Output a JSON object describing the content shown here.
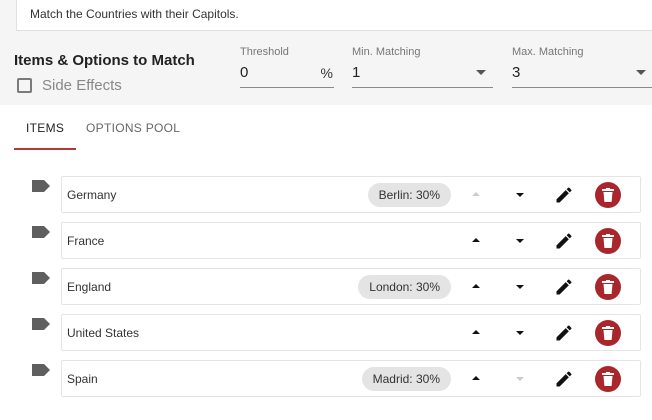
{
  "question": {
    "text": "Match the Countries with their Capitols."
  },
  "section": {
    "title": "Items & Options to Match",
    "side_effects_label": "Side Effects",
    "side_effects_checked": false
  },
  "fields": {
    "threshold": {
      "label": "Threshold",
      "value": "0",
      "suffix": "%"
    },
    "min_matching": {
      "label": "Min. Matching",
      "value": "1"
    },
    "max_matching": {
      "label": "Max. Matching",
      "value": "3"
    }
  },
  "tabs": [
    {
      "label": "ITEMS",
      "active": true
    },
    {
      "label": "OPTIONS POOL",
      "active": false
    }
  ],
  "items": [
    {
      "label": "Germany",
      "chip": "Berlin: 30%",
      "up_enabled": false,
      "down_enabled": true
    },
    {
      "label": "France",
      "chip": "",
      "up_enabled": true,
      "down_enabled": true
    },
    {
      "label": "England",
      "chip": "London: 30%",
      "up_enabled": true,
      "down_enabled": true
    },
    {
      "label": "United States",
      "chip": "",
      "up_enabled": true,
      "down_enabled": true
    },
    {
      "label": "Spain",
      "chip": "Madrid: 30%",
      "up_enabled": true,
      "down_enabled": false
    }
  ],
  "icons": {
    "row": "label-tag-icon",
    "up": "arrow-up-icon",
    "down": "arrow-down-icon",
    "edit": "pencil-icon",
    "delete": "trash-icon"
  },
  "colors": {
    "accent": "#b03a3a",
    "delete": "#a8262c",
    "chip": "#e4e4e4"
  }
}
